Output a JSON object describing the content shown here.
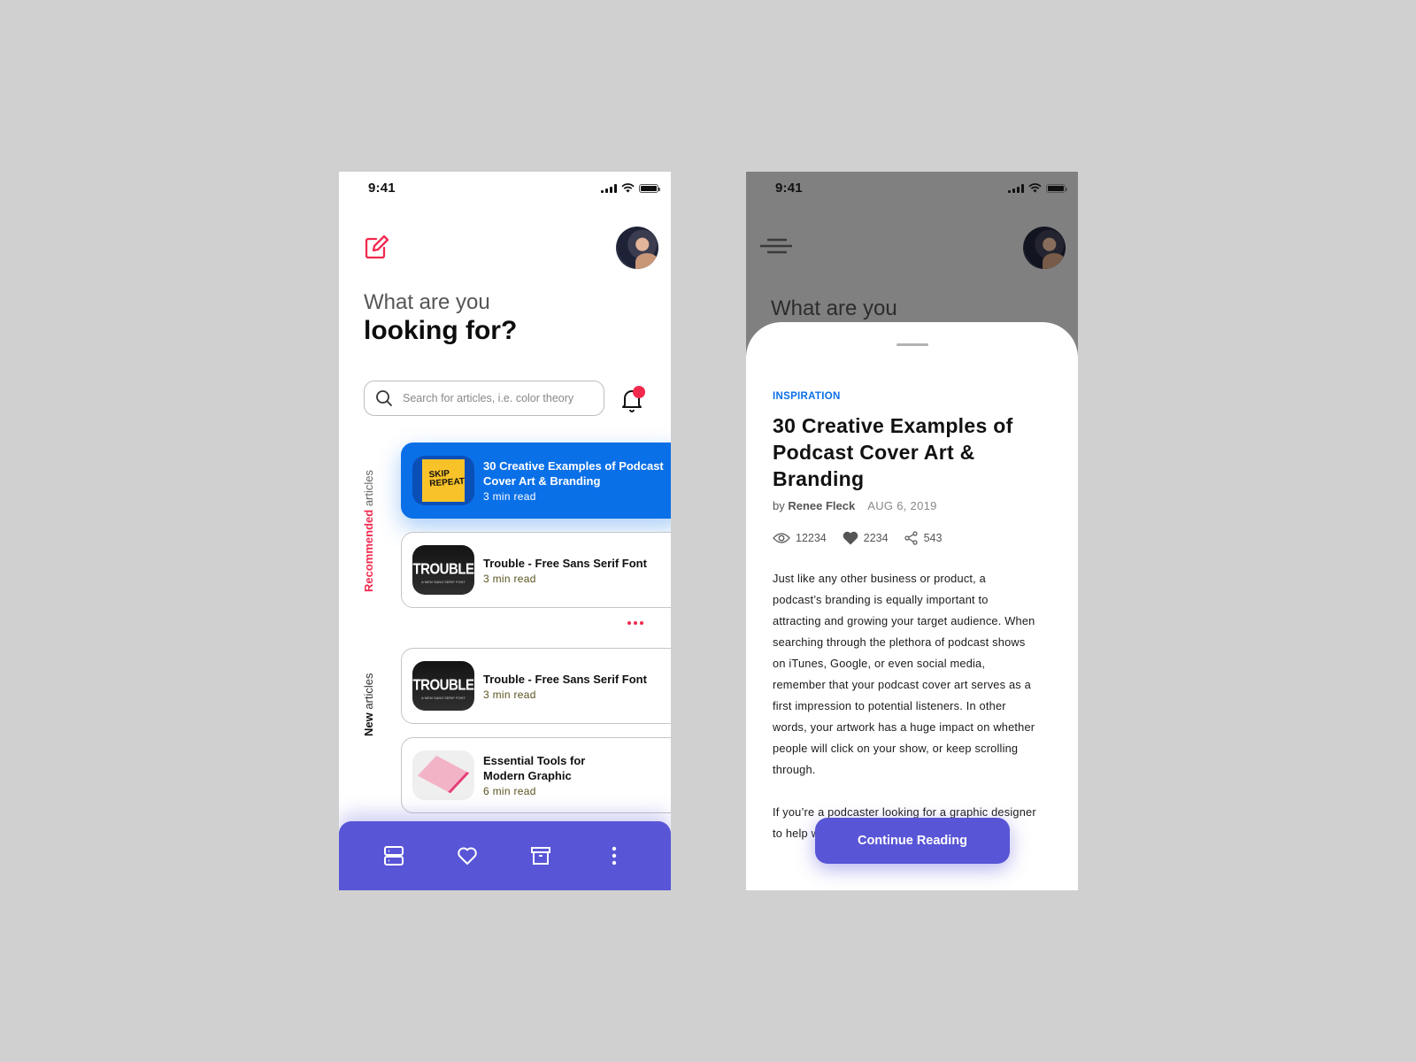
{
  "status_bar": {
    "time": "9:41"
  },
  "home": {
    "greeting_line1": "What are you",
    "greeting_line2": "looking for?",
    "search": {
      "placeholder": "Search for articles, i.e. color theory",
      "value": ""
    },
    "sections": {
      "recommended": {
        "bold": "Recommended",
        "rest": " articles"
      },
      "new": {
        "bold": "New",
        "rest": " articles"
      }
    },
    "recommended_articles": [
      {
        "title": "30 Creative Examples of Podcast Cover Art & Branding",
        "read_time": "3 min read",
        "thumb_text": "SKIP REPEAT"
      },
      {
        "title": "Trouble - Free Sans Serif Font",
        "read_time": "3 min read",
        "thumb_text": "TROUBLE",
        "thumb_sub": "A NEW SANS SERIF FONT"
      }
    ],
    "new_articles": [
      {
        "title": "Trouble - Free Sans Serif Font",
        "read_time": "3 min read",
        "thumb_text": "TROUBLE",
        "thumb_sub": "A NEW SANS SERIF FONT"
      },
      {
        "title": "Essential Tools for Modern Graphic",
        "read_time": "6 min read"
      }
    ],
    "tabbar": [
      "stack-icon",
      "heart-icon",
      "archive-icon",
      "more-vertical-icon"
    ]
  },
  "detail": {
    "ghost_title": "What are you",
    "category": "INSPIRATION",
    "title": "30 Creative Examples of Podcast Cover Art & Branding",
    "by_prefix": "by ",
    "author": "Renee Fleck",
    "date": "AUG 6, 2019",
    "stats": {
      "views": "12234",
      "likes": "2234",
      "shares": "543"
    },
    "paragraphs": [
      "Just like any other business or product, a podcast’s branding is equally important to attracting and growing your target audience. When searching through the plethora of podcast shows on iTunes, Google, or even social media, remember that your podcast cover art serves as a first impression to potential listeners. In other words, your artwork has a huge impact on whether people will click on your show, or keep scrolling through.",
      "If you’re a podcaster looking for a graphic designer to help with your cover art, read on."
    ],
    "cta_label": "Continue Reading"
  },
  "colors": {
    "accent_blue": "#0a70e8",
    "accent_pink": "#f2294e",
    "accent_purple": "#5855d6"
  }
}
